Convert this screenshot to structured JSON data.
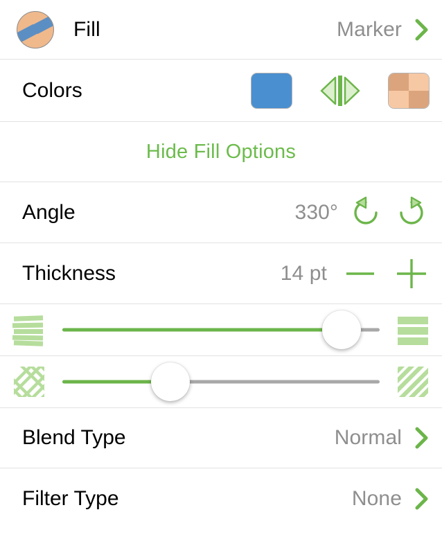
{
  "header": {
    "icon_name": "fill-marker-swatch-icon",
    "title": "Fill",
    "value": "Marker",
    "chevron": "chevron-right-icon"
  },
  "colors": {
    "label": "Colors",
    "primary_swatch": {
      "name": "primary-color-swatch",
      "color": "#4A8FD0"
    },
    "swap": {
      "name": "swap-colors-icon"
    },
    "secondary_swatch": {
      "name": "secondary-color-swatch",
      "colors": [
        "#DBA47C",
        "#F6C8A4",
        "#F6C8A4",
        "#DBA47C"
      ]
    }
  },
  "hide_fill_options": {
    "label": "Hide Fill Options"
  },
  "angle": {
    "label": "Angle",
    "value": "330°",
    "rotate_ccw": "rotate-counterclockwise-icon",
    "rotate_cw": "rotate-clockwise-icon"
  },
  "thickness": {
    "label": "Thickness",
    "value": "14 pt",
    "decrement": "minus-icon",
    "increment": "plus-icon"
  },
  "sliders": [
    {
      "name": "stripe-density-slider",
      "left_icon": "dense-horizontal-stripes-icon",
      "right_icon": "sparse-horizontal-stripes-icon",
      "percent": 88
    },
    {
      "name": "hatch-scale-slider",
      "left_icon": "basketweave-hatch-icon",
      "right_icon": "diagonal-stripes-icon",
      "percent": 34
    }
  ],
  "blend_type": {
    "label": "Blend Type",
    "value": "Normal",
    "chevron": "chevron-right-icon"
  },
  "filter_type": {
    "label": "Filter Type",
    "value": "None",
    "chevron": "chevron-right-icon"
  },
  "colors_accent": {
    "green": "#6cb54a",
    "green_light": "#b6dd9c",
    "gray_value": "#8e8e8e",
    "separator": "#e2e2e2"
  }
}
